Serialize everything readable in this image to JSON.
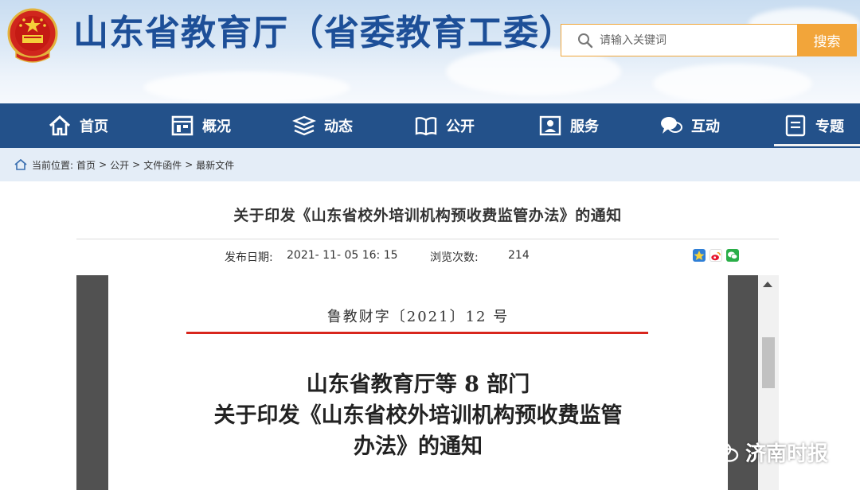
{
  "header": {
    "site_title": "山东省教育厅（省委教育工委）",
    "search_placeholder": "请输入关键词",
    "search_button": "搜索"
  },
  "nav": {
    "items": [
      {
        "label": "首页",
        "icon": "home-icon"
      },
      {
        "label": "概况",
        "icon": "building-icon"
      },
      {
        "label": "动态",
        "icon": "stack-icon"
      },
      {
        "label": "公开",
        "icon": "open-book-icon"
      },
      {
        "label": "服务",
        "icon": "service-icon"
      },
      {
        "label": "互动",
        "icon": "chat-icon"
      },
      {
        "label": "专题",
        "icon": "document-icon"
      }
    ],
    "active_index": 6
  },
  "breadcrumb": {
    "prefix": "当前位置:",
    "items": [
      "首页",
      "公开",
      "文件函件",
      "最新文件"
    ],
    "separator": ">"
  },
  "article": {
    "title": "关于印发《山东省校外培训机构预收费监管办法》的通知",
    "date_label": "发布日期:",
    "date_value": "2021- 11- 05 16: 15",
    "views_label": "浏览次数:",
    "views_value": "214"
  },
  "document": {
    "number": "鲁教财字〔2021〕12 号",
    "heading_lines": [
      "山东省教育厅等 8 部门",
      "关于印发《山东省校外培训机构预收费监管",
      "办法》的通知"
    ]
  },
  "watermark": {
    "text": "济南时报"
  },
  "colors": {
    "brand_blue": "#1d4f98",
    "nav_blue": "#23518a",
    "accent_orange": "#f2a53a",
    "redline": "#d8261d"
  }
}
